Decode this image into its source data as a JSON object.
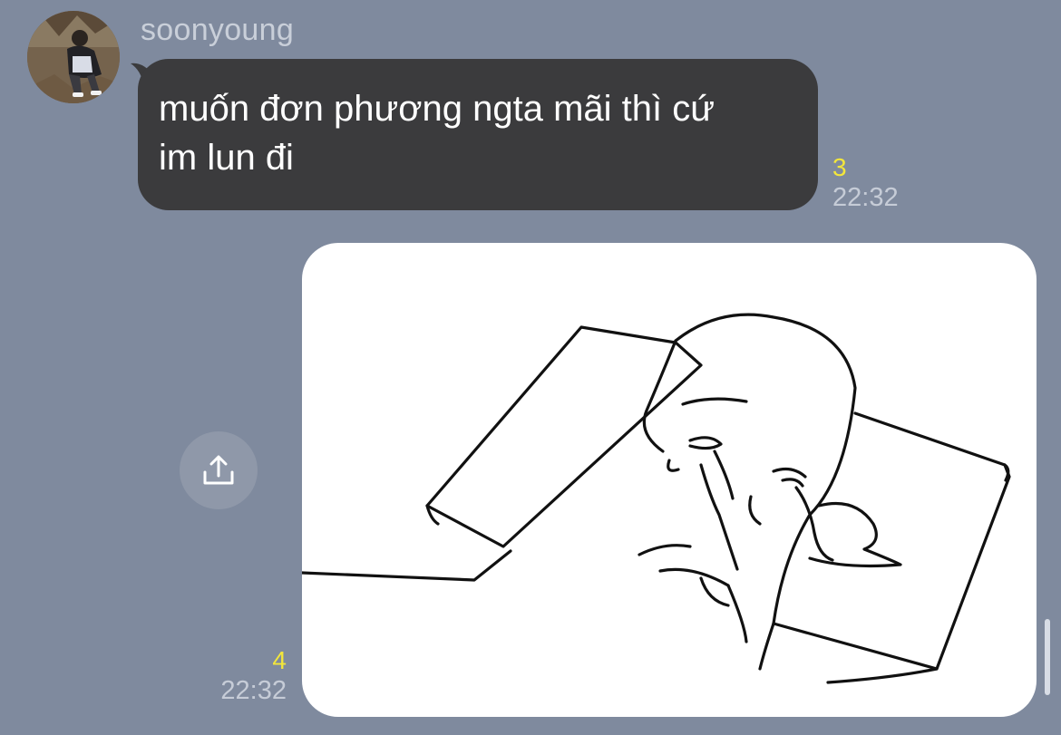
{
  "chat": {
    "incoming": {
      "sender_name": "soonyoung",
      "avatar_icon": "profile-photo-person-crouching",
      "message_lines": [
        "muốn đơn phương ngta mãi thì cứ",
        "im lun đi"
      ],
      "unread_count": "3",
      "time": "22:32"
    },
    "outgoing": {
      "attachment_type": "image",
      "image_subject": "crying-face-on-pillow-drawing",
      "unread_count": "4",
      "time": "22:32",
      "share_icon": "share-icon"
    }
  },
  "colors": {
    "background": "#7f8a9e",
    "incoming_bubble": "#3b3b3d",
    "unread_count": "#f3e63b",
    "timestamp": "#c6ccd7"
  }
}
